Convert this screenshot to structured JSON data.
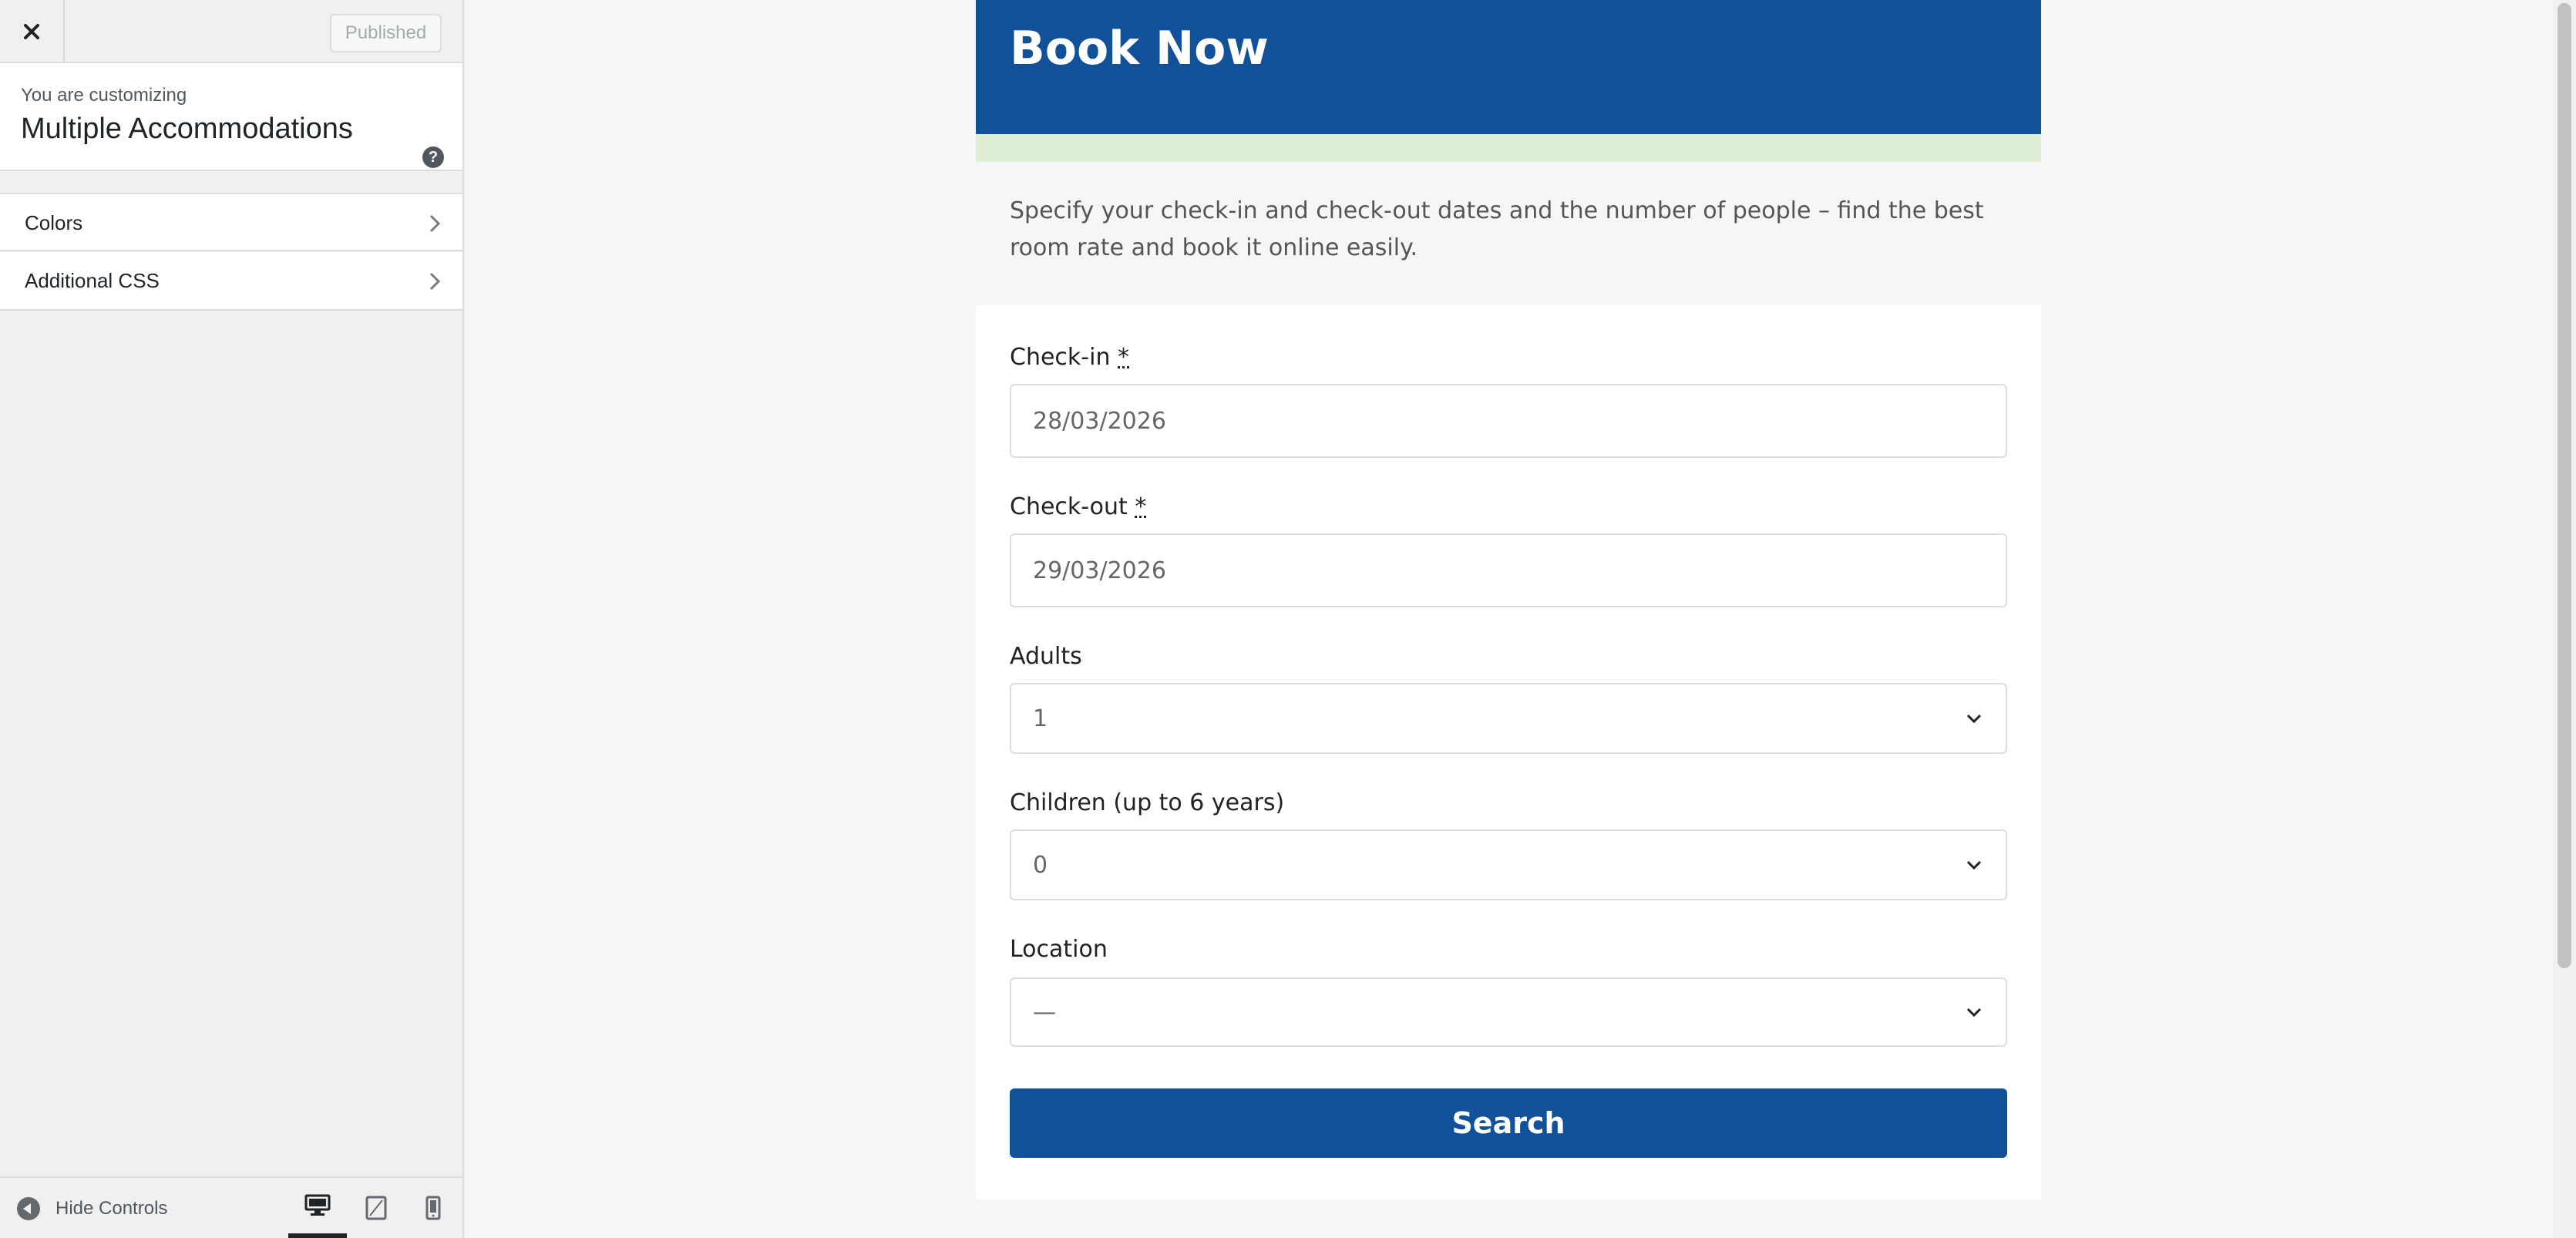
{
  "customizer": {
    "published_label": "Published",
    "info_small": "You are customizing",
    "info_title": "Multiple Accommodations",
    "panels": [
      {
        "label": "Colors"
      },
      {
        "label": "Additional CSS"
      }
    ],
    "hide_controls_label": "Hide Controls",
    "active_device": "desktop"
  },
  "page": {
    "title": "Book Now",
    "intro": "Specify your check-in and check-out dates and the number of people – find the best room rate and book it online easily.",
    "colors": {
      "header": "#10519a",
      "strip": "#deefd6",
      "button": "#10519a"
    }
  },
  "form": {
    "checkin": {
      "label": "Check-in",
      "required_mark": "*",
      "value": "28/03/2026"
    },
    "checkout": {
      "label": "Check-out",
      "required_mark": "*",
      "value": "29/03/2026"
    },
    "adults": {
      "label": "Adults",
      "value": "1"
    },
    "children": {
      "label": "Children (up to 6 years)",
      "value": "0"
    },
    "location": {
      "label": "Location",
      "value": "—"
    },
    "search_label": "Search"
  }
}
